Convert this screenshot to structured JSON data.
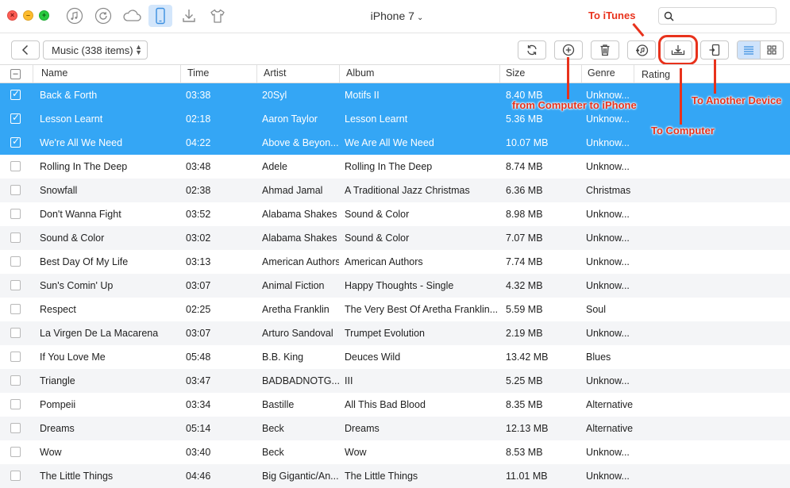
{
  "window": {
    "device_title": "iPhone 7",
    "search_placeholder": ""
  },
  "top_icons": [
    "music-note-icon",
    "restore-icon",
    "cloud-icon",
    "phone-icon",
    "download-icon",
    "tshirt-icon"
  ],
  "toolbar": {
    "category_select": "Music (338 items)"
  },
  "columns": [
    "Name",
    "Time",
    "Artist",
    "Album",
    "Size",
    "Genre",
    "Rating"
  ],
  "rows": [
    {
      "name": "Back & Forth",
      "time": "03:38",
      "artist": "20Syl",
      "album": "Motifs II",
      "size": "8.40 MB",
      "genre": "Unknow...",
      "selected": true
    },
    {
      "name": "Lesson Learnt",
      "time": "02:18",
      "artist": "Aaron Taylor",
      "album": "Lesson Learnt",
      "size": "5.36 MB",
      "genre": "Unknow...",
      "selected": true
    },
    {
      "name": "We're All We Need",
      "time": "04:22",
      "artist": "Above & Beyon...",
      "album": "We Are All We Need",
      "size": "10.07 MB",
      "genre": "Unknow...",
      "selected": true
    },
    {
      "name": "Rolling In The Deep",
      "time": "03:48",
      "artist": "Adele",
      "album": "Rolling In The Deep",
      "size": "8.74 MB",
      "genre": "Unknow...",
      "selected": false
    },
    {
      "name": "Snowfall",
      "time": "02:38",
      "artist": "Ahmad Jamal",
      "album": "A Traditional Jazz Christmas",
      "size": "6.36 MB",
      "genre": "Christmas",
      "selected": false
    },
    {
      "name": "Don't Wanna Fight",
      "time": "03:52",
      "artist": "Alabama Shakes",
      "album": "Sound & Color",
      "size": "8.98 MB",
      "genre": "Unknow...",
      "selected": false
    },
    {
      "name": "Sound & Color",
      "time": "03:02",
      "artist": "Alabama Shakes",
      "album": "Sound & Color",
      "size": "7.07 MB",
      "genre": "Unknow...",
      "selected": false
    },
    {
      "name": "Best Day Of My Life",
      "time": "03:13",
      "artist": "American Authors",
      "album": "American Authors",
      "size": "7.74 MB",
      "genre": "Unknow...",
      "selected": false
    },
    {
      "name": "Sun's Comin' Up",
      "time": "03:07",
      "artist": "Animal Fiction",
      "album": "Happy Thoughts - Single",
      "size": "4.32 MB",
      "genre": "Unknow...",
      "selected": false
    },
    {
      "name": "Respect",
      "time": "02:25",
      "artist": "Aretha Franklin",
      "album": "The Very Best Of Aretha Franklin...",
      "size": "5.59 MB",
      "genre": "Soul",
      "selected": false
    },
    {
      "name": "La Virgen De La Macarena",
      "time": "03:07",
      "artist": "Arturo Sandoval",
      "album": "Trumpet Evolution",
      "size": "2.19 MB",
      "genre": "Unknow...",
      "selected": false
    },
    {
      "name": "If You Love Me",
      "time": "05:48",
      "artist": "B.B. King",
      "album": "Deuces Wild",
      "size": "13.42 MB",
      "genre": "Blues",
      "selected": false
    },
    {
      "name": "Triangle",
      "time": "03:47",
      "artist": "BADBADNOTG...",
      "album": "III",
      "size": "5.25 MB",
      "genre": "Unknow...",
      "selected": false
    },
    {
      "name": "Pompeii",
      "time": "03:34",
      "artist": "Bastille",
      "album": "All This Bad Blood",
      "size": "8.35 MB",
      "genre": "Alternative",
      "selected": false
    },
    {
      "name": "Dreams",
      "time": "05:14",
      "artist": "Beck",
      "album": "Dreams",
      "size": "12.13 MB",
      "genre": "Alternative",
      "selected": false
    },
    {
      "name": "Wow",
      "time": "03:40",
      "artist": "Beck",
      "album": "Wow",
      "size": "8.53 MB",
      "genre": "Unknow...",
      "selected": false
    },
    {
      "name": "The Little Things",
      "time": "04:46",
      "artist": "Big Gigantic/An...",
      "album": "The Little Things",
      "size": "11.01 MB",
      "genre": "Unknow...",
      "selected": false
    }
  ],
  "annotations": {
    "to_itunes": "To iTunes",
    "from_computer": "from Computer to iPhone",
    "to_another_device": "To Another Device",
    "to_computer": "To Computer"
  },
  "colors": {
    "selection": "#34a6f5",
    "annotation": "#e8321c",
    "active_tab": "#d3e6fb"
  }
}
